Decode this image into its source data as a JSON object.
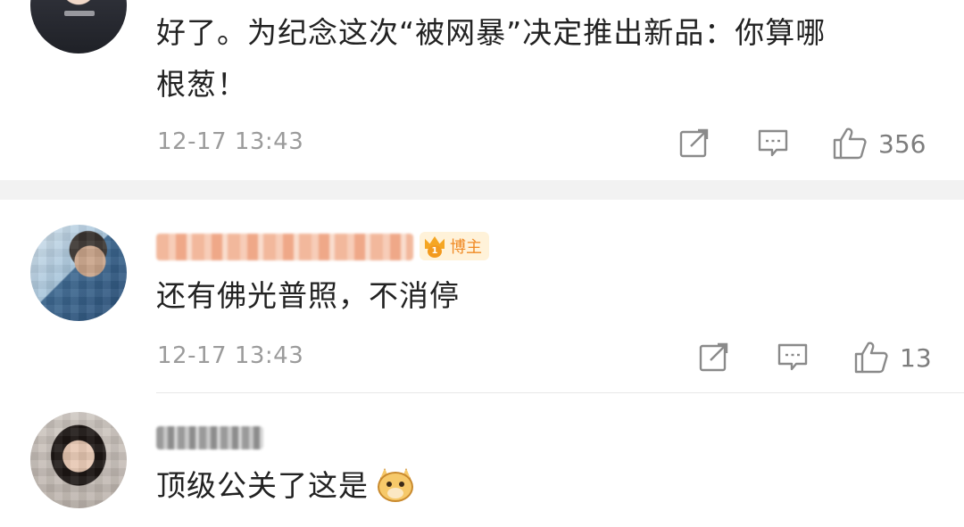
{
  "comments": [
    {
      "text_line1": "好了。为纪念这次“被网暴”决定推出新品：你算哪",
      "text_line2": "根葱！",
      "time": "12-17 13:43",
      "likes": "356"
    },
    {
      "badge": "博主",
      "badge_rank": "1",
      "text": "还有佛光普照，不消停",
      "time": "12-17 13:43",
      "likes": "13"
    },
    {
      "text": "顶级公关了这是"
    }
  ],
  "icons": {
    "share": "share-icon",
    "comment": "comment-icon",
    "like": "thumbs-up-icon",
    "emoji": "doge-emoji-icon",
    "badge": "crown-icon"
  },
  "colors": {
    "text": "#222222",
    "meta": "#9b9b9b",
    "badge_text": "#f08a24",
    "badge_bg": "#fff2d9",
    "divider": "#f2f2f2"
  }
}
